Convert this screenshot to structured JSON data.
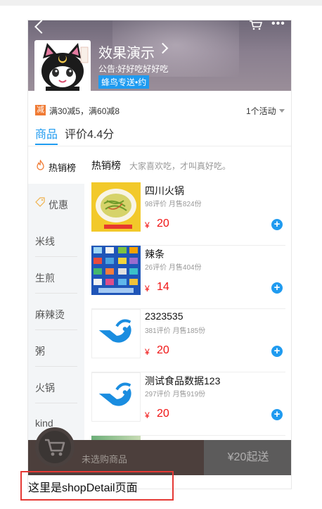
{
  "header": {
    "shop_name": "效果演示",
    "notice": "公告:好好吃好好吃",
    "delivery_badge": "蜂鸟专送•约"
  },
  "promo": {
    "icon_text": "减",
    "text": "满30减5，满60减8",
    "activity_count": "1个活动"
  },
  "tabs": [
    {
      "label": "商品",
      "active": true
    },
    {
      "label": "评价4.4分",
      "active": false
    }
  ],
  "sidebar": {
    "items": [
      {
        "label": "热销榜",
        "icon": "fire-icon",
        "active": true
      },
      {
        "label": "优惠",
        "icon": "tag-icon",
        "active": false
      },
      {
        "label": "米线"
      },
      {
        "label": "生煎"
      },
      {
        "label": "麻辣烫"
      },
      {
        "label": "粥"
      },
      {
        "label": "火锅"
      },
      {
        "label": "kind"
      }
    ]
  },
  "section": {
    "title": "热销榜",
    "description": "大家喜欢吃，才叫真好吃。"
  },
  "foods": [
    {
      "name": "四川火锅",
      "meta": "98评价 月售824份",
      "currency": "¥",
      "price": "20",
      "thumb": "noodle-dish"
    },
    {
      "name": "辣条",
      "meta": "26评价 月售404份",
      "currency": "¥",
      "price": "14",
      "thumb": "app-icons-grid"
    },
    {
      "name": "2323535",
      "meta": "381评价 月售185份",
      "currency": "¥",
      "price": "20",
      "thumb": "blue-logo"
    },
    {
      "name": "测试食品数据123",
      "meta": "297评价 月售919份",
      "currency": "¥",
      "price": "20",
      "thumb": "blue-logo"
    }
  ],
  "cart": {
    "empty_text": "未选购商品",
    "checkout_label": "¥20起送"
  },
  "page_note": "这里是shopDetail页面",
  "colors": {
    "accent": "#1f9bf0",
    "price": "#f01414",
    "promo": "#f07a33",
    "cartbar": "#4c3f3c"
  }
}
